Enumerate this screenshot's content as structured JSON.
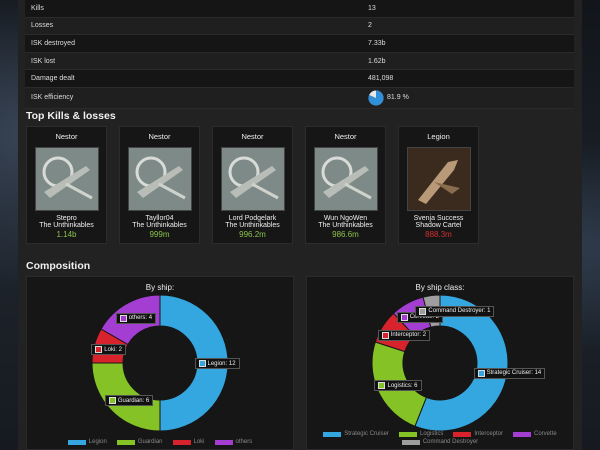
{
  "stats": [
    {
      "label": "Kills",
      "value": "13"
    },
    {
      "label": "Losses",
      "value": "2"
    },
    {
      "label": "ISK destroyed",
      "value": "7.33b"
    },
    {
      "label": "ISK lost",
      "value": "1.62b"
    },
    {
      "label": "Damage dealt",
      "value": "481,098"
    },
    {
      "label": "ISK efficiency",
      "value": "81.9 %",
      "fraction": 0.819
    }
  ],
  "top_title": "Top Kills & losses",
  "cards": [
    {
      "ship": "Nestor",
      "pilot": "Stepro",
      "corp": "The Unthinkables",
      "value": "1.14b",
      "color": "#8bc34a",
      "icon": "nestor-ship-icon"
    },
    {
      "ship": "Nestor",
      "pilot": "Tayllor04",
      "corp": "The Unthinkables",
      "value": "999m",
      "color": "#8bc34a",
      "icon": "nestor-ship-icon"
    },
    {
      "ship": "Nestor",
      "pilot": "Lord Podgelark",
      "corp": "The Unthinkables",
      "value": "996.2m",
      "color": "#8bc34a",
      "icon": "nestor-ship-icon"
    },
    {
      "ship": "Nestor",
      "pilot": "Wun NgoWen",
      "corp": "The Unthinkables",
      "value": "986.6m",
      "color": "#8bc34a",
      "icon": "nestor-ship-icon"
    },
    {
      "ship": "Legion",
      "pilot": "Svenja Success",
      "corp": "Shadow Cartel",
      "value": "888.3m",
      "color": "#d32f2f",
      "icon": "legion-ship-icon"
    }
  ],
  "composition_title": "Composition",
  "chart_data": [
    {
      "type": "pie",
      "title": "By ship:",
      "categories": [
        "Legion",
        "Guardian",
        "Loki",
        "others"
      ],
      "values": [
        12,
        6,
        2,
        4
      ],
      "colors": [
        "#35a7e0",
        "#84c225",
        "#d8222c",
        "#a43ed3"
      ]
    },
    {
      "type": "pie",
      "title": "By ship class:",
      "categories": [
        "Strategic Cruiser",
        "Logistics",
        "Interceptor",
        "Corvette",
        "Command Destroyer"
      ],
      "values": [
        14,
        6,
        2,
        2,
        1
      ],
      "colors": [
        "#35a7e0",
        "#84c225",
        "#d8222c",
        "#a43ed3",
        "#9e9e9e"
      ]
    }
  ]
}
